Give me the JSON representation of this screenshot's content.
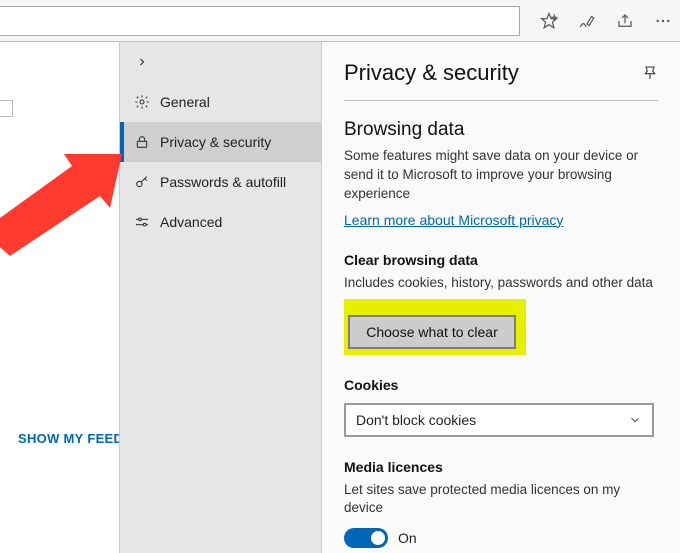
{
  "topbar": {
    "favorites_icon": "favorites-icon",
    "inking_icon": "inking-icon",
    "share_icon": "share-icon",
    "more_icon": "more-icon"
  },
  "content_left": {
    "show_feed": "SHOW MY FEED"
  },
  "sidebar": {
    "items": [
      {
        "label": "General"
      },
      {
        "label": "Privacy & security"
      },
      {
        "label": "Passwords & autofill"
      },
      {
        "label": "Advanced"
      }
    ]
  },
  "main": {
    "title": "Privacy & security",
    "section1": {
      "heading": "Browsing data",
      "desc": "Some features might save data on your device or send it to Microsoft to improve your browsing experience",
      "link": "Learn more about Microsoft privacy"
    },
    "section2": {
      "heading": "Clear browsing data",
      "desc": "Includes cookies, history, passwords and other data",
      "button": "Choose what to clear"
    },
    "section3": {
      "heading": "Cookies",
      "select_value": "Don't block cookies"
    },
    "section4": {
      "heading": "Media licences",
      "desc": "Let sites save protected media licences on my device",
      "toggle_state": "On"
    }
  }
}
